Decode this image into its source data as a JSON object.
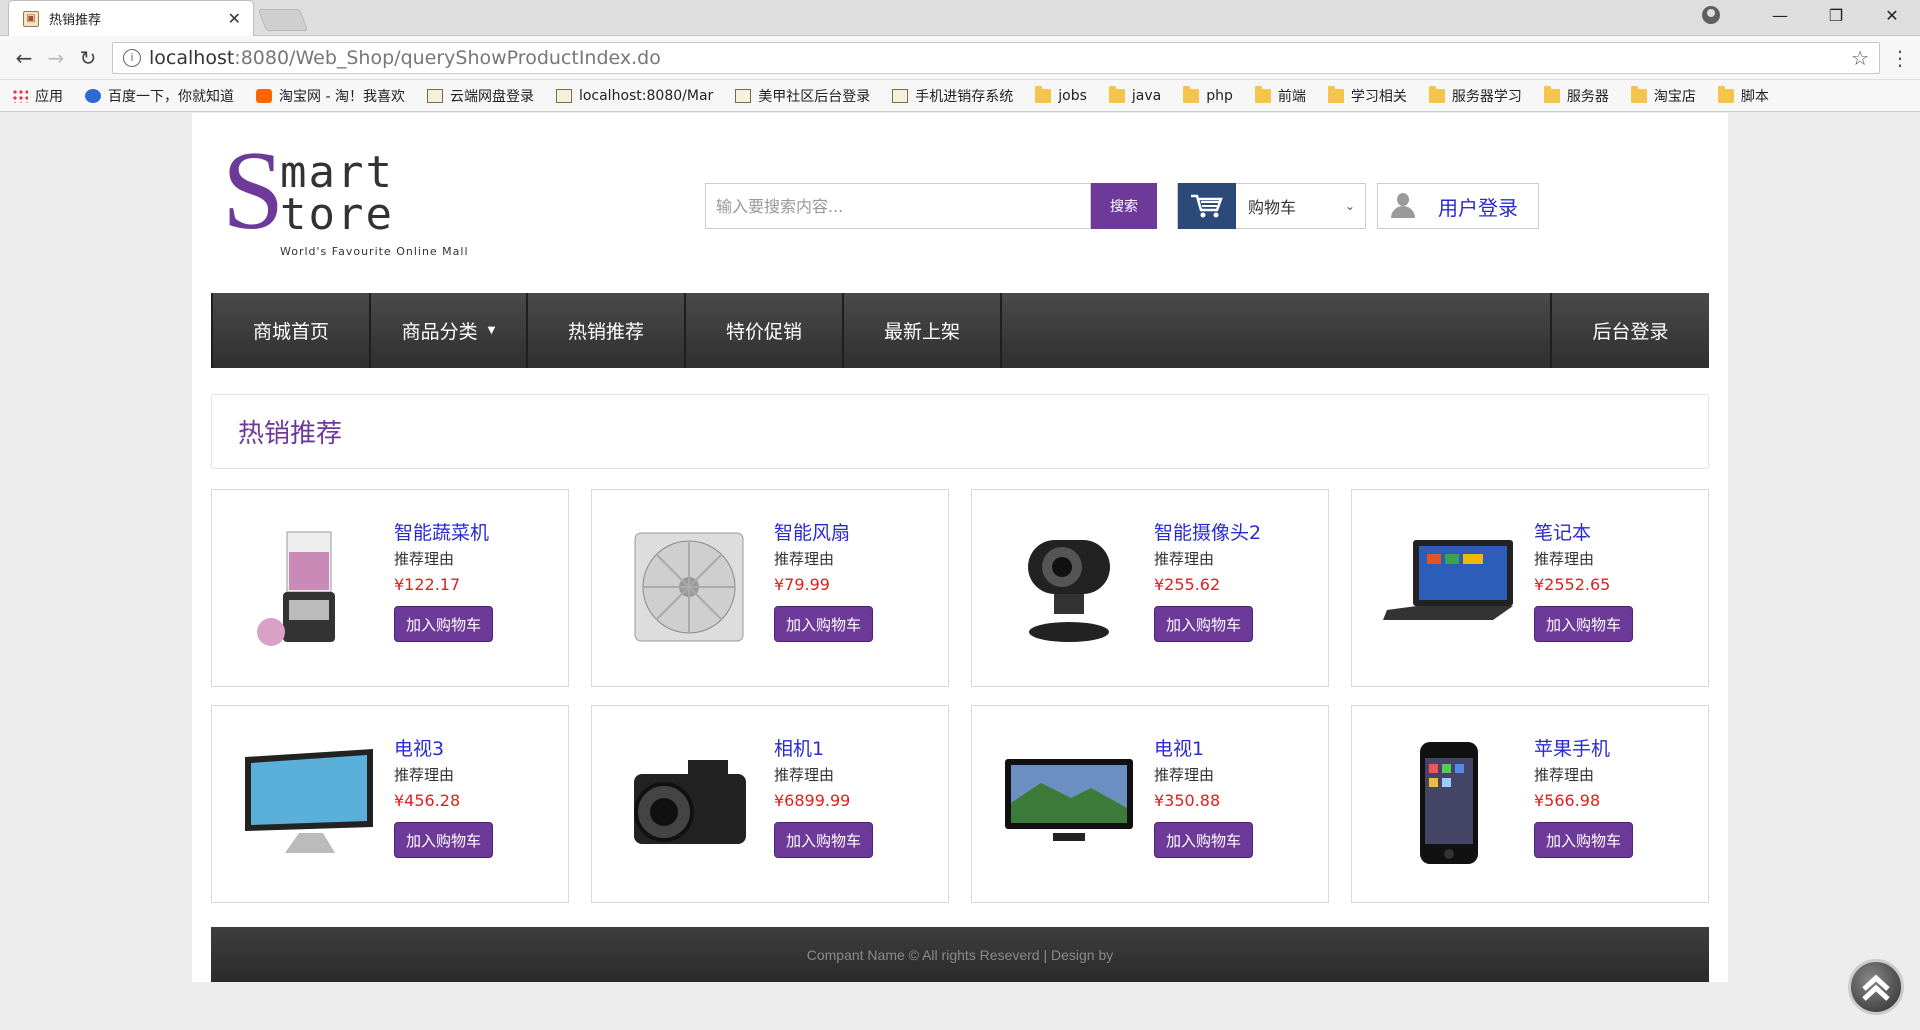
{
  "browser": {
    "tab_title": "热销推荐",
    "url_host": "localhost",
    "url_rest": ":8080/Web_Shop/queryShowProductIndex.do",
    "bookmarks": [
      {
        "label": "应用",
        "icon": "apps-grid-icon"
      },
      {
        "label": "百度一下，你就知道",
        "icon": "baidu-paw-icon"
      },
      {
        "label": "淘宝网 - 淘！我喜欢",
        "icon": "taobao-icon"
      },
      {
        "label": "云端网盘登录",
        "icon": "page-icon"
      },
      {
        "label": "localhost:8080/Mar",
        "icon": "page-icon"
      },
      {
        "label": "美甲社区后台登录",
        "icon": "page-icon"
      },
      {
        "label": "手机进销存系统",
        "icon": "page-icon"
      },
      {
        "label": "jobs",
        "icon": "folder-icon"
      },
      {
        "label": "java",
        "icon": "folder-icon"
      },
      {
        "label": "php",
        "icon": "folder-icon"
      },
      {
        "label": "前端",
        "icon": "folder-icon"
      },
      {
        "label": "学习相关",
        "icon": "folder-icon"
      },
      {
        "label": "服务器学习",
        "icon": "folder-icon"
      },
      {
        "label": "服务器",
        "icon": "folder-icon"
      },
      {
        "label": "淘宝店",
        "icon": "folder-icon"
      },
      {
        "label": "脚本",
        "icon": "folder-icon"
      }
    ]
  },
  "logo": {
    "s": "S",
    "line1": "mart",
    "line2": "tore",
    "tagline": "World's Favourite Online Mall"
  },
  "search": {
    "placeholder": "输入要搜索内容...",
    "button": "搜索"
  },
  "cart": {
    "label": "购物车"
  },
  "login": {
    "label": "用户登录"
  },
  "nav": {
    "home": "商城首页",
    "categories": "商品分类",
    "hot": "热销推荐",
    "sale": "特价促销",
    "new": "最新上架",
    "admin": "后台登录"
  },
  "section": {
    "title": "热销推荐"
  },
  "products": [
    {
      "name": "智能蔬菜机",
      "reason": "推荐理由",
      "price": "¥122.17",
      "button": "加入购物车",
      "icon": "food-processor-icon"
    },
    {
      "name": "智能风扇",
      "reason": "推荐理由",
      "price": "¥79.99",
      "button": "加入购物车",
      "icon": "fan-icon"
    },
    {
      "name": "智能摄像头2",
      "reason": "推荐理由",
      "price": "¥255.62",
      "button": "加入购物车",
      "icon": "webcam-icon"
    },
    {
      "name": "笔记本",
      "reason": "推荐理由",
      "price": "¥2552.65",
      "button": "加入购物车",
      "icon": "laptop-icon"
    },
    {
      "name": "电视3",
      "reason": "推荐理由",
      "price": "¥456.28",
      "button": "加入购物车",
      "icon": "monitor-icon"
    },
    {
      "name": "相机1",
      "reason": "推荐理由",
      "price": "¥6899.99",
      "button": "加入购物车",
      "icon": "camera-icon"
    },
    {
      "name": "电视1",
      "reason": "推荐理由",
      "price": "¥350.88",
      "button": "加入购物车",
      "icon": "tv-icon"
    },
    {
      "name": "苹果手机",
      "reason": "推荐理由",
      "price": "¥566.98",
      "button": "加入购物车",
      "icon": "smartphone-icon"
    }
  ],
  "footer": {
    "text": "Compant Name © All rights Reseverd | Design by"
  },
  "colors": {
    "brand_purple": "#6e3a9a",
    "link_blue": "#2a2ad4",
    "price_red": "#e02020",
    "nav_dark": "#3a3a3a"
  }
}
